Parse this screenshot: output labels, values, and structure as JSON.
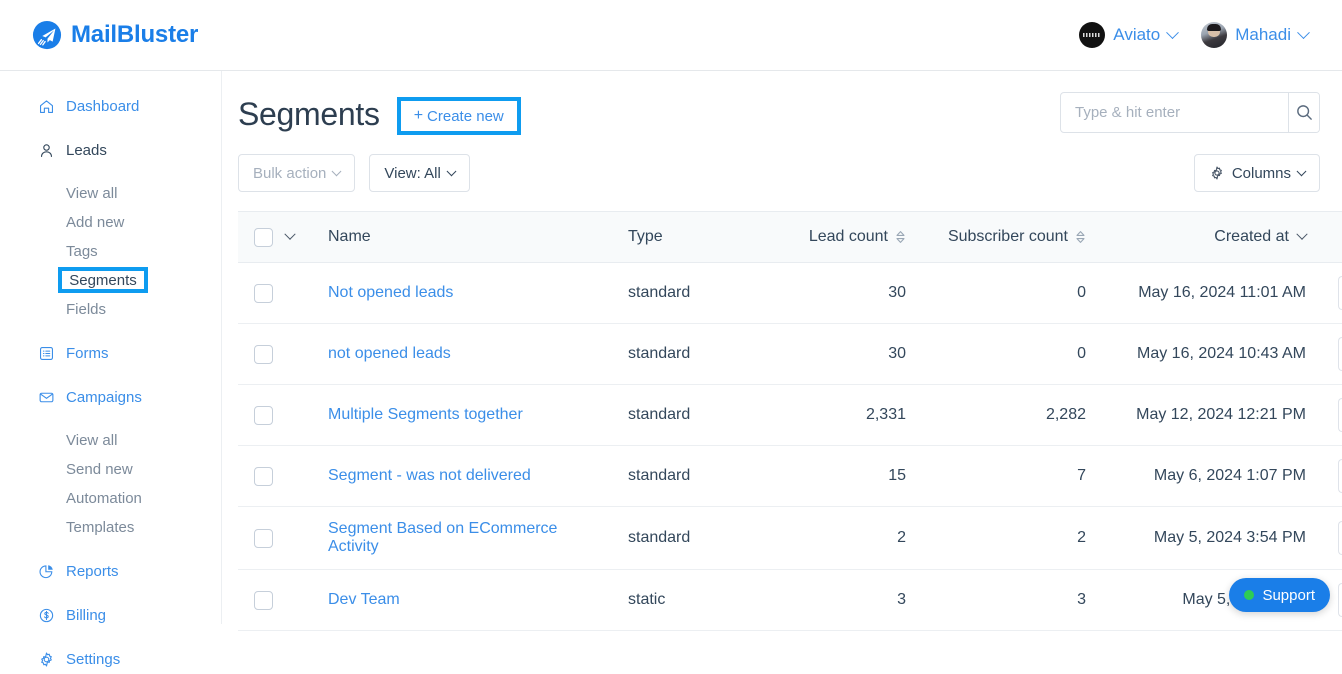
{
  "brand": {
    "name": "MailBluster",
    "logo_icon": "paper-plane-logo-icon",
    "color": "#1a7ee8"
  },
  "topbar": {
    "accounts": [
      {
        "name": "Aviato",
        "avatar_icon": "aviato-avatar",
        "caret_icon": "chevron-down-icon"
      },
      {
        "name": "Mahadi",
        "avatar_icon": "user-avatar",
        "caret_icon": "chevron-down-icon"
      }
    ]
  },
  "sidebar": {
    "items": [
      {
        "label": "Dashboard",
        "icon": "home-icon",
        "type": "top"
      },
      {
        "label": "Leads",
        "icon": "user-icon",
        "type": "top"
      },
      {
        "label": "View all",
        "type": "sub"
      },
      {
        "label": "Add new",
        "type": "sub"
      },
      {
        "label": "Tags",
        "type": "sub"
      },
      {
        "label": "Segments",
        "type": "sub",
        "highlighted": true
      },
      {
        "label": "Fields",
        "type": "sub"
      },
      {
        "label": "Forms",
        "icon": "form-icon",
        "type": "top"
      },
      {
        "label": "Campaigns",
        "icon": "envelope-icon",
        "type": "top"
      },
      {
        "label": "View all",
        "type": "sub"
      },
      {
        "label": "Send new",
        "type": "sub"
      },
      {
        "label": "Automation",
        "type": "sub"
      },
      {
        "label": "Templates",
        "type": "sub"
      },
      {
        "label": "Reports",
        "icon": "pie-chart-icon",
        "type": "top"
      },
      {
        "label": "Billing",
        "icon": "dollar-circle-icon",
        "type": "top"
      },
      {
        "label": "Settings",
        "icon": "gear-icon",
        "type": "top"
      }
    ],
    "highlight_color": "#0e9cf0"
  },
  "page": {
    "title": "Segments",
    "create_new_label": "Create new",
    "create_new_plus": "+",
    "create_new_highlight_color": "#0e9cf0"
  },
  "search": {
    "placeholder": "Type & hit enter",
    "value": "",
    "icon": "search-icon"
  },
  "toolbar": {
    "bulk_action_label": "Bulk action",
    "view_label": "View: All",
    "columns_label": "Columns",
    "columns_icon": "gear-icon",
    "caret_icon": "chevron-down-icon"
  },
  "table": {
    "headers": {
      "name": "Name",
      "type": "Type",
      "lead_count": "Lead count",
      "subscriber_count": "Subscriber count",
      "created_at": "Created at"
    },
    "sort": {
      "lead_count": "sortable",
      "subscriber_count": "sortable",
      "created_at": "desc"
    },
    "rows": [
      {
        "name": "Not opened leads",
        "type": "standard",
        "lead_count": "30",
        "subscriber_count": "0",
        "created_at": "May 16, 2024 11:01 AM"
      },
      {
        "name": "not opened leads",
        "type": "standard",
        "lead_count": "30",
        "subscriber_count": "0",
        "created_at": "May 16, 2024 10:43 AM"
      },
      {
        "name": "Multiple Segments together",
        "type": "standard",
        "lead_count": "2,331",
        "subscriber_count": "2,282",
        "created_at": "May 12, 2024 12:21 PM"
      },
      {
        "name": "Segment - was not delivered",
        "type": "standard",
        "lead_count": "15",
        "subscriber_count": "7",
        "created_at": "May 6, 2024 1:07 PM"
      },
      {
        "name": "Segment Based on ECommerce Activity",
        "type": "standard",
        "lead_count": "2",
        "subscriber_count": "2",
        "created_at": "May 5, 2024 3:54 PM"
      },
      {
        "name": "Dev Team",
        "type": "static",
        "lead_count": "3",
        "subscriber_count": "3",
        "created_at": "May 5, 2024 12:3"
      }
    ]
  },
  "support": {
    "label": "Support",
    "status_icon": "online-dot",
    "status_color": "#2ecc55",
    "bg_color": "#1a7ee8"
  }
}
